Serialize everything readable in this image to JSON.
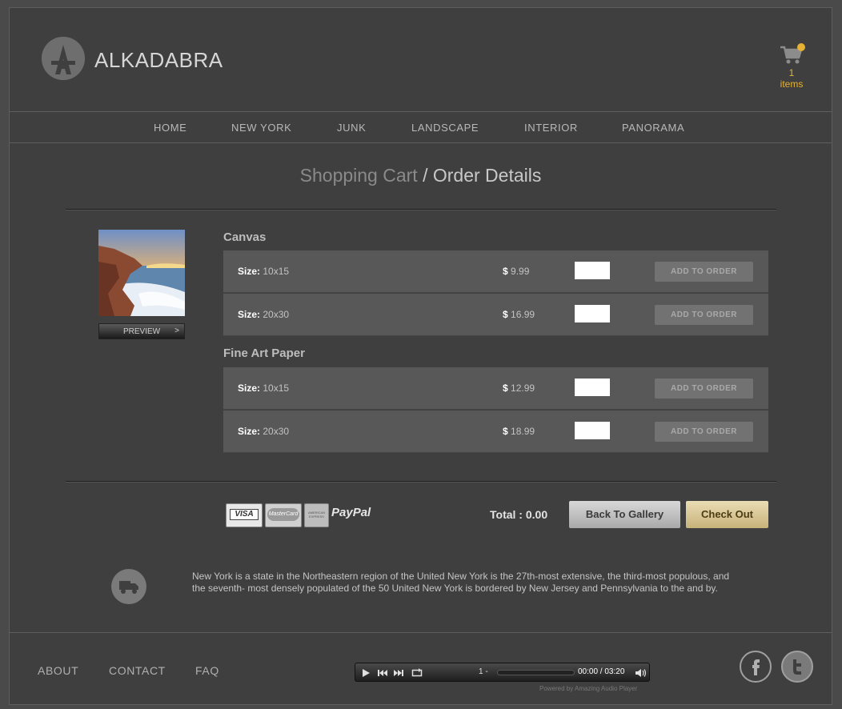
{
  "header": {
    "brand": "ALKADABRA",
    "cart_count": "1",
    "cart_label": "items",
    "accent_color": "#e5b233"
  },
  "nav": {
    "items": [
      {
        "label": "HOME"
      },
      {
        "label": "NEW YORK"
      },
      {
        "label": "JUNK"
      },
      {
        "label": "LANDSCAPE"
      },
      {
        "label": "INTERIOR"
      },
      {
        "label": "PANORAMA"
      }
    ]
  },
  "page": {
    "title_primary": "Shopping Cart",
    "title_separator": " / ",
    "title_secondary": "Order Details"
  },
  "product": {
    "preview_label": "PREVIEW",
    "preview_arrow": ">",
    "groups": [
      {
        "name": "Canvas",
        "options": [
          {
            "size_label": "Size:",
            "size": "10x15",
            "currency": "$",
            "price": "9.99",
            "qty": "",
            "action": "ADD TO ORDER"
          },
          {
            "size_label": "Size:",
            "size": "20x30",
            "currency": "$",
            "price": "16.99",
            "qty": "",
            "action": "ADD TO ORDER"
          }
        ]
      },
      {
        "name": "Fine Art Paper",
        "options": [
          {
            "size_label": "Size:",
            "size": "10x15",
            "currency": "$",
            "price": "12.99",
            "qty": "",
            "action": "ADD TO ORDER"
          },
          {
            "size_label": "Size:",
            "size": "20x30",
            "currency": "$",
            "price": "18.99",
            "qty": "",
            "action": "ADD TO ORDER"
          }
        ]
      }
    ]
  },
  "payments": {
    "visa": "VISA",
    "mastercard": "MasterCard",
    "amex": "AMERICAN EXPRESS",
    "paypal": "PayPal"
  },
  "totals": {
    "label": "Total :",
    "value": "0.00",
    "back_button": "Back To Gallery",
    "checkout_button": "Check Out"
  },
  "info": {
    "icon": "truck-icon",
    "text": "New York is a state in the Northeastern region of the United New York is the 27th-most extensive, the third-most populous, and the seventh- most densely populated of the 50 United New York is bordered by New Jersey and Pennsylvania to the and by."
  },
  "footer": {
    "links": [
      {
        "label": "ABOUT"
      },
      {
        "label": "CONTACT"
      },
      {
        "label": "FAQ"
      }
    ],
    "player": {
      "track": "1 -",
      "time": "00:00 / 03:20",
      "powered_by": "Powered by Amazing Audio Player",
      "progress": 0
    },
    "social": [
      "facebook-icon",
      "twitter-icon"
    ]
  }
}
